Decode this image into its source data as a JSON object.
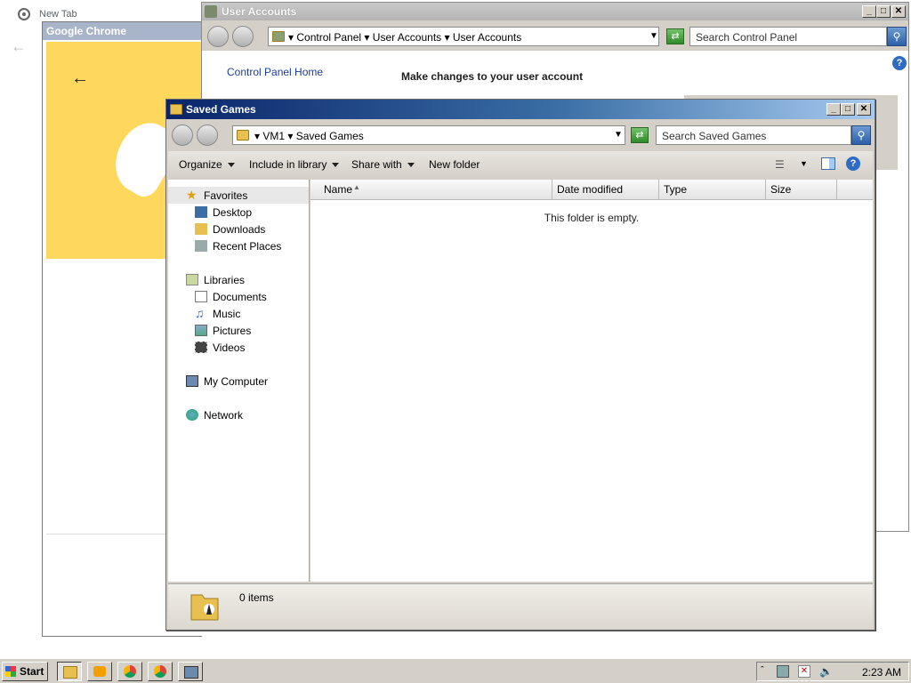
{
  "chrome": {
    "tab_title": "New Tab",
    "window_title": "Google Chrome"
  },
  "user_accounts": {
    "title": "User Accounts",
    "breadcrumb": [
      "Control Panel",
      "User Accounts",
      "User Accounts"
    ],
    "search_placeholder": "Search Control Panel",
    "cp_home_link": "Control Panel Home",
    "heading": "Make changes to your user account",
    "help_icon": "?"
  },
  "saved_games": {
    "title": "Saved Games",
    "breadcrumb": [
      "VM1",
      "Saved Games"
    ],
    "search_placeholder": "Search Saved Games",
    "toolbar": {
      "organize": "Organize",
      "include_in_library": "Include in library",
      "share_with": "Share with",
      "new_folder": "New folder"
    },
    "nav": {
      "favorites": "Favorites",
      "desktop": "Desktop",
      "downloads": "Downloads",
      "recent_places": "Recent Places",
      "libraries": "Libraries",
      "documents": "Documents",
      "music": "Music",
      "pictures": "Pictures",
      "videos": "Videos",
      "my_computer": "My Computer",
      "network": "Network"
    },
    "columns": [
      "Name",
      "Date modified",
      "Type",
      "Size"
    ],
    "empty_message": "This folder is empty.",
    "status_count": "0 items"
  },
  "taskbar": {
    "start_label": "Start",
    "clock": "2:23 AM"
  },
  "colors": {
    "title_active_start": "#0a246a",
    "title_active_end": "#a6caf0",
    "chrome_yellow": "#fdd85d",
    "link_blue": "#1a3d9a"
  }
}
